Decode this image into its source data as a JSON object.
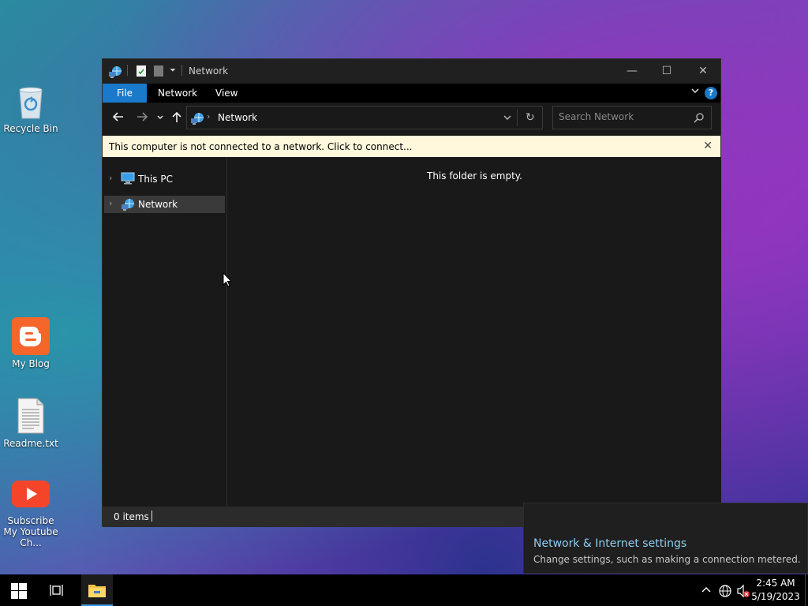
{
  "desktop": {
    "icons": [
      {
        "label": "Recycle Bin"
      },
      {
        "label": "My Blog"
      },
      {
        "label": "Readme.txt"
      },
      {
        "label": "Subscribe My Youtube Ch..."
      }
    ]
  },
  "window": {
    "title": "Network",
    "ribbon_tabs": [
      "File",
      "Network",
      "View"
    ],
    "help_label": "?",
    "address": {
      "path": "Network"
    },
    "search": {
      "placeholder": "Search Network"
    },
    "infobar": {
      "message": "This computer is not connected to a network. Click to connect..."
    },
    "nav_pane": {
      "items": [
        {
          "label": "This PC",
          "selected": false
        },
        {
          "label": "Network",
          "selected": true
        }
      ]
    },
    "content": {
      "empty_message": "This folder is empty."
    },
    "status": {
      "item_count": "0 items"
    }
  },
  "toast": {
    "title": "Network & Internet settings",
    "subtitle": "Change settings, such as making a connection metered."
  },
  "taskbar": {
    "time": "2:45 AM",
    "date": "5/19/2023"
  },
  "colors": {
    "accent": "#1979ca",
    "infobar_bg": "#fff8dc",
    "toast_title": "#8ecdf2"
  }
}
